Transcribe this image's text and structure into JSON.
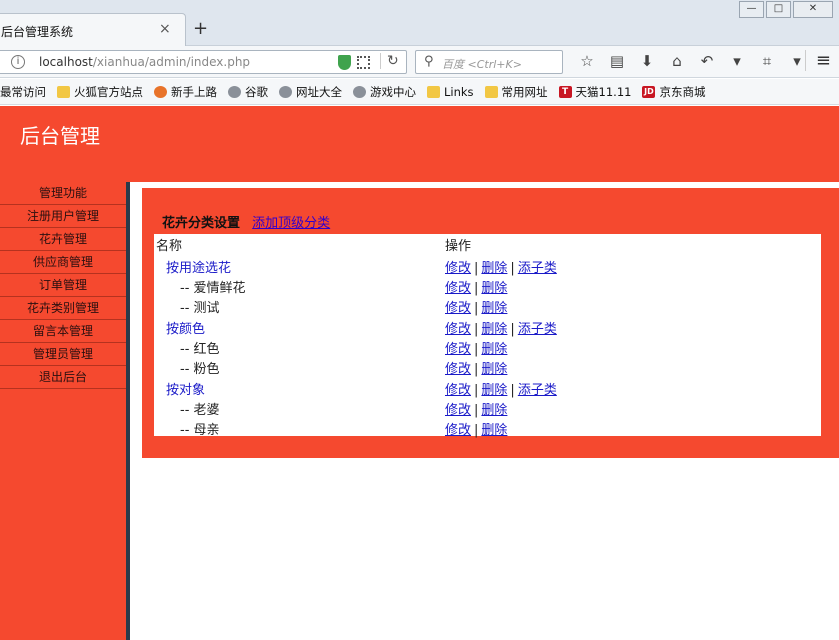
{
  "browser": {
    "tab_title": "后台管理系统",
    "tab_close": "×",
    "new_tab": "+",
    "url_host": "localhost",
    "url_path": "/xianhua/admin/index.php",
    "search_placeholder": "百度 <Ctrl+K>",
    "bookmarks": [
      {
        "label": "最常访问",
        "icon": "none"
      },
      {
        "label": "火狐官方站点",
        "icon": "folder"
      },
      {
        "label": "新手上路",
        "icon": "fox"
      },
      {
        "label": "谷歌",
        "icon": "globe"
      },
      {
        "label": "网址大全",
        "icon": "globe"
      },
      {
        "label": "游戏中心",
        "icon": "globe"
      },
      {
        "label": "Links",
        "icon": "folder"
      },
      {
        "label": "常用网址",
        "icon": "folder"
      },
      {
        "label": "天猫11.11",
        "icon": "tmall"
      },
      {
        "label": "京东商城",
        "icon": "jd"
      }
    ]
  },
  "header": {
    "title": "后台管理"
  },
  "sidebar": {
    "items": [
      "管理功能",
      "注册用户管理",
      "花卉管理",
      "供应商管理",
      "订单管理",
      "花卉类别管理",
      "留言本管理",
      "管理员管理",
      "退出后台"
    ]
  },
  "panel": {
    "title": "花卉分类设置",
    "add_link": "添加顶级分类",
    "col_name": "名称",
    "col_ops": "操作",
    "op_edit": "修改",
    "op_delete": "删除",
    "op_add_child": "添子类",
    "op_sep": "|",
    "rows": [
      {
        "name": "按用途选花",
        "level": 0
      },
      {
        "name": "-- 爱情鲜花",
        "level": 1
      },
      {
        "name": "-- 测试",
        "level": 1
      },
      {
        "name": "按颜色",
        "level": 0
      },
      {
        "name": "-- 红色",
        "level": 1
      },
      {
        "name": "-- 粉色",
        "level": 1
      },
      {
        "name": "按对象",
        "level": 0
      },
      {
        "name": "-- 老婆",
        "level": 1
      },
      {
        "name": "-- 母亲",
        "level": 1
      }
    ]
  },
  "colors": {
    "accent": "#f5492f",
    "link": "#1a1ac8"
  }
}
